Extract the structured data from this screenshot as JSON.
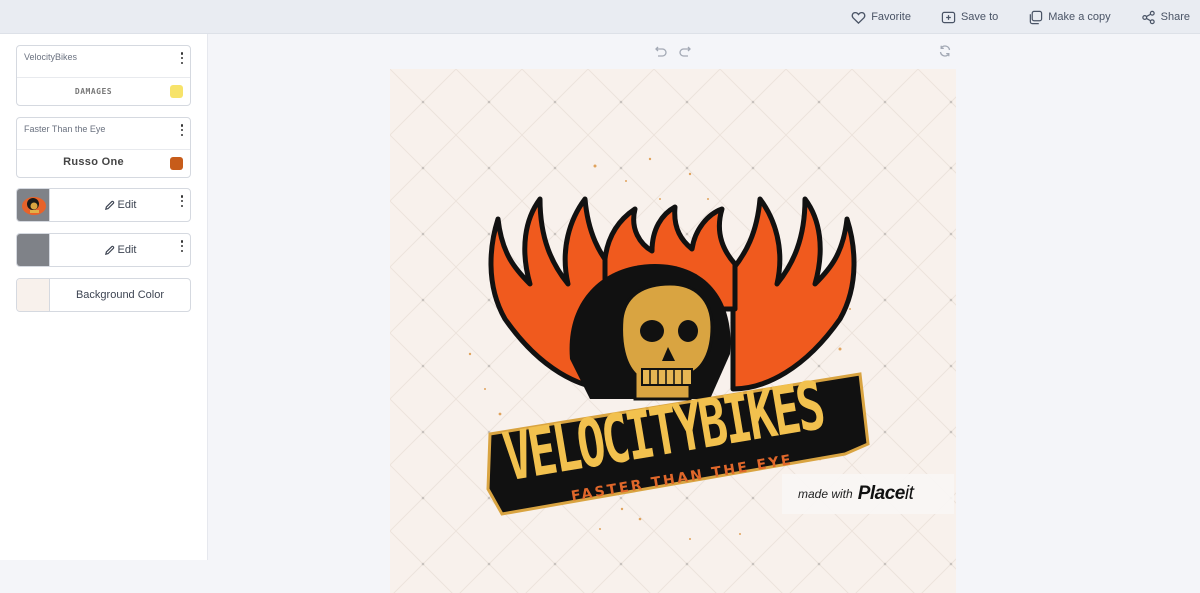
{
  "topbar": {
    "actions": [
      {
        "label": "Favorite",
        "icon": "heart-icon"
      },
      {
        "label": "Save to",
        "icon": "folder-plus-icon"
      },
      {
        "label": "Make a copy",
        "icon": "copy-icon"
      },
      {
        "label": "Share",
        "icon": "share-icon"
      }
    ]
  },
  "sidebar": {
    "text_layers": [
      {
        "text": "VelocityBikes",
        "font": "DAMAGES",
        "color": "#f7e36a"
      },
      {
        "text": "Faster Than the Eye",
        "font": "Russo One",
        "color": "#c75c1a"
      }
    ],
    "image_layers": [
      {
        "edit_label": "Edit",
        "thumb": "skull-logo-thumbnail"
      },
      {
        "edit_label": "Edit",
        "thumb": "grey-texture-thumbnail"
      }
    ],
    "background": {
      "label": "Background Color",
      "color": "#f8f1ec"
    }
  },
  "canvas_toolbar": {
    "undo": "undo-icon",
    "redo": "redo-icon",
    "refresh": "refresh-icon"
  },
  "canvas": {
    "background_color": "#f8f1ec",
    "logo": {
      "title": "VELOCITYBIKES",
      "tagline": "FASTER THAN THE EYE",
      "title_color": "#f2c14e",
      "tagline_color": "#e0672a",
      "flame_color": "#f05a1e"
    },
    "watermark": {
      "prefix": "made with",
      "brand_bold": "Place",
      "brand_light": "it"
    }
  }
}
